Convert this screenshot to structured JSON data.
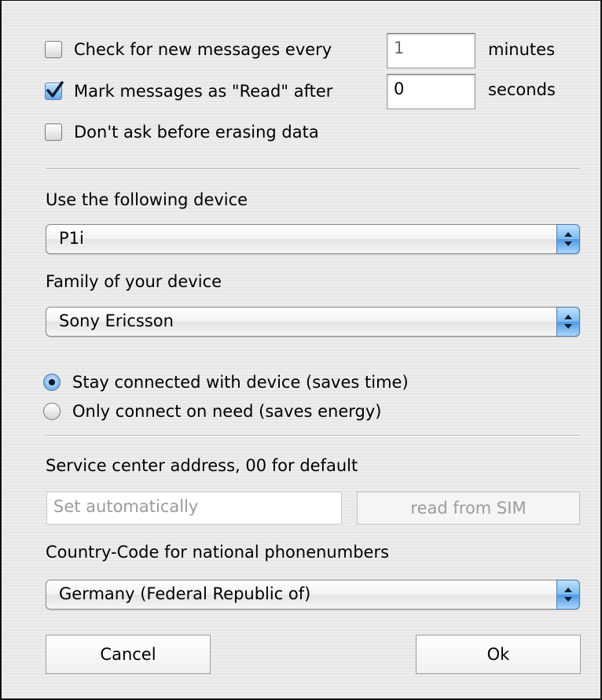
{
  "options": {
    "check_new_messages": {
      "checked": false,
      "label": "Check for new messages every",
      "value": "1",
      "unit": "minutes"
    },
    "mark_read": {
      "checked": true,
      "label": "Mark messages as \"Read\" after",
      "value": "0",
      "unit": "seconds"
    },
    "dont_ask_erase": {
      "checked": false,
      "label": "Don't ask before erasing data"
    }
  },
  "device": {
    "label": "Use the following device",
    "selected": "P1i"
  },
  "family": {
    "label": "Family of your device",
    "selected": "Sony Ericsson"
  },
  "connection": {
    "stay_connected": {
      "selected": true,
      "label": "Stay connected with device (saves time)"
    },
    "connect_on_need": {
      "selected": false,
      "label": "Only connect on need (saves energy)"
    }
  },
  "service_center": {
    "label": "Service center address, 00 for default",
    "placeholder": "Set automatically",
    "read_button": "read from SIM"
  },
  "country": {
    "label": "Country-Code for national phonenumbers",
    "selected": "Germany (Federal Republic of)"
  },
  "buttons": {
    "cancel": "Cancel",
    "ok": "Ok"
  },
  "colors": {
    "accent": "#4f98e0",
    "window_bg": "#ececec"
  }
}
